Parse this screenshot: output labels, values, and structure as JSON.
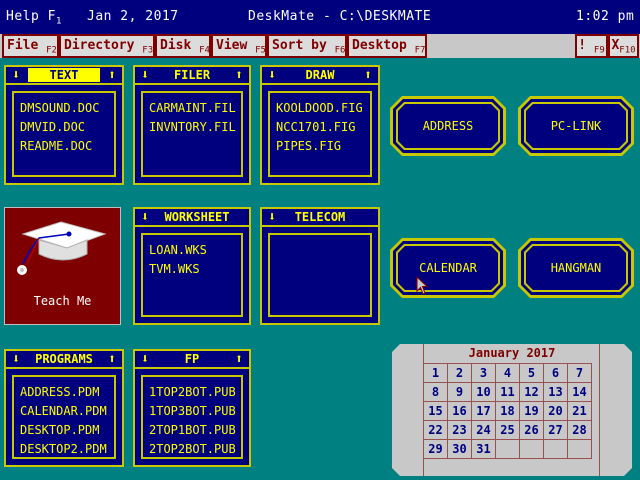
{
  "status_bar": {
    "help": "Help",
    "help_key": "F",
    "help_key_num": "1",
    "date": "Jan 2, 2017",
    "title": "DeskMate - C:\\DESKMATE",
    "time": "1:02 pm"
  },
  "menu": [
    {
      "label": "File",
      "key": "F2"
    },
    {
      "label": "Directory",
      "key": "F3"
    },
    {
      "label": "Disk",
      "key": "F4"
    },
    {
      "label": "View",
      "key": "F5"
    },
    {
      "label": "Sort by",
      "key": "F6"
    },
    {
      "label": "Desktop",
      "key": "F7"
    }
  ],
  "menu_right": {
    "help_mark": "!",
    "help_key": "F9",
    "exit_mark": "X",
    "exit_key": "F10"
  },
  "folders": {
    "text": {
      "title": "TEXT",
      "files": [
        "DMSOUND.DOC",
        "DMVID.DOC",
        "README.DOC"
      ]
    },
    "filer": {
      "title": "FILER",
      "files": [
        "CARMAINT.FIL",
        "INVNTORY.FIL"
      ]
    },
    "draw": {
      "title": "DRAW",
      "files": [
        "KOOLDOOD.FIG",
        "NCC1701.FIG",
        "PIPES.FIG"
      ]
    },
    "worksheet": {
      "title": "WORKSHEET",
      "files": [
        "LOAN.WKS",
        "TVM.WKS"
      ]
    },
    "telecom": {
      "title": "TELECOM",
      "files": []
    },
    "programs": {
      "title": "PROGRAMS",
      "files": [
        "ADDRESS.PDM",
        "CALENDAR.PDM",
        "DESKTOP.PDM",
        "DESKTOP2.PDM"
      ]
    },
    "fp": {
      "title": "FP",
      "files": [
        "1TOP2BOT.PUB",
        "1TOP3BOT.PUB",
        "2TOP1BOT.PUB",
        "2TOP2BOT.PUB"
      ]
    }
  },
  "apps": {
    "address": "ADDRESS",
    "pclink": "PC-LINK",
    "calendar": "CALENDAR",
    "hangman": "HANGMAN"
  },
  "teach_me": "Teach Me",
  "calendar": {
    "month_label": "January 2017",
    "days": [
      "1",
      "2",
      "3",
      "4",
      "5",
      "6",
      "7",
      "8",
      "9",
      "10",
      "11",
      "12",
      "13",
      "14",
      "15",
      "16",
      "17",
      "18",
      "19",
      "20",
      "21",
      "22",
      "23",
      "24",
      "25",
      "26",
      "27",
      "28",
      "29",
      "30",
      "31",
      "",
      "",
      "",
      ""
    ]
  },
  "colors": {
    "desktop": "#008080",
    "panel": "#00007f",
    "accent": "#ffff00",
    "menu_text": "#7f0000"
  },
  "icons": {
    "folder_down": "down-arrow-icon",
    "folder_up": "up-arrow-icon",
    "teach": "graduation-cap-icon",
    "cursor": "mouse-pointer-icon"
  }
}
